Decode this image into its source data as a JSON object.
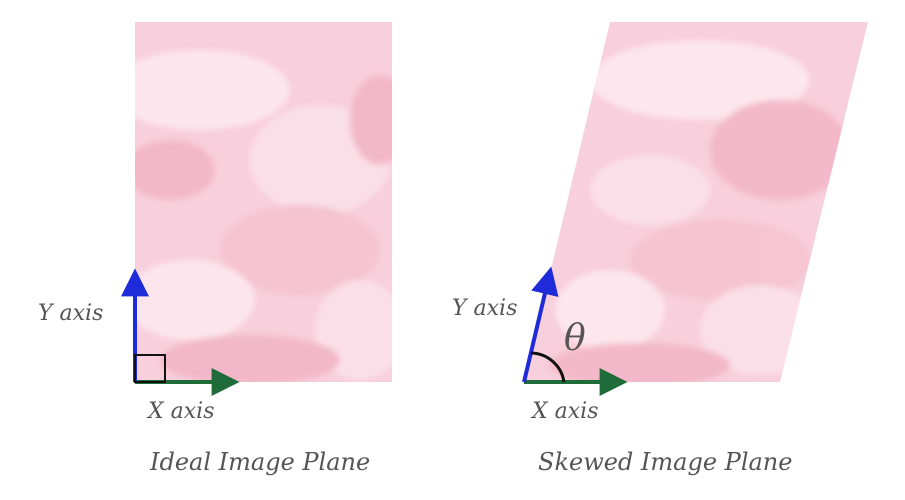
{
  "left_panel": {
    "title": "Ideal Image Plane",
    "y_axis_label": "Y axis",
    "x_axis_label": "X axis"
  },
  "right_panel": {
    "title": "Skewed Image Plane",
    "y_axis_label": "Y axis",
    "x_axis_label": "X axis",
    "angle_label": "θ"
  },
  "colors": {
    "plane_fill": "#f8cfdc",
    "plane_highlight": "#fde8ef",
    "plane_shade": "#f2b6c8",
    "y_axis": "#1f2bd8",
    "x_axis": "#1f6b3a",
    "marker": "#111111",
    "text": "#555555"
  }
}
